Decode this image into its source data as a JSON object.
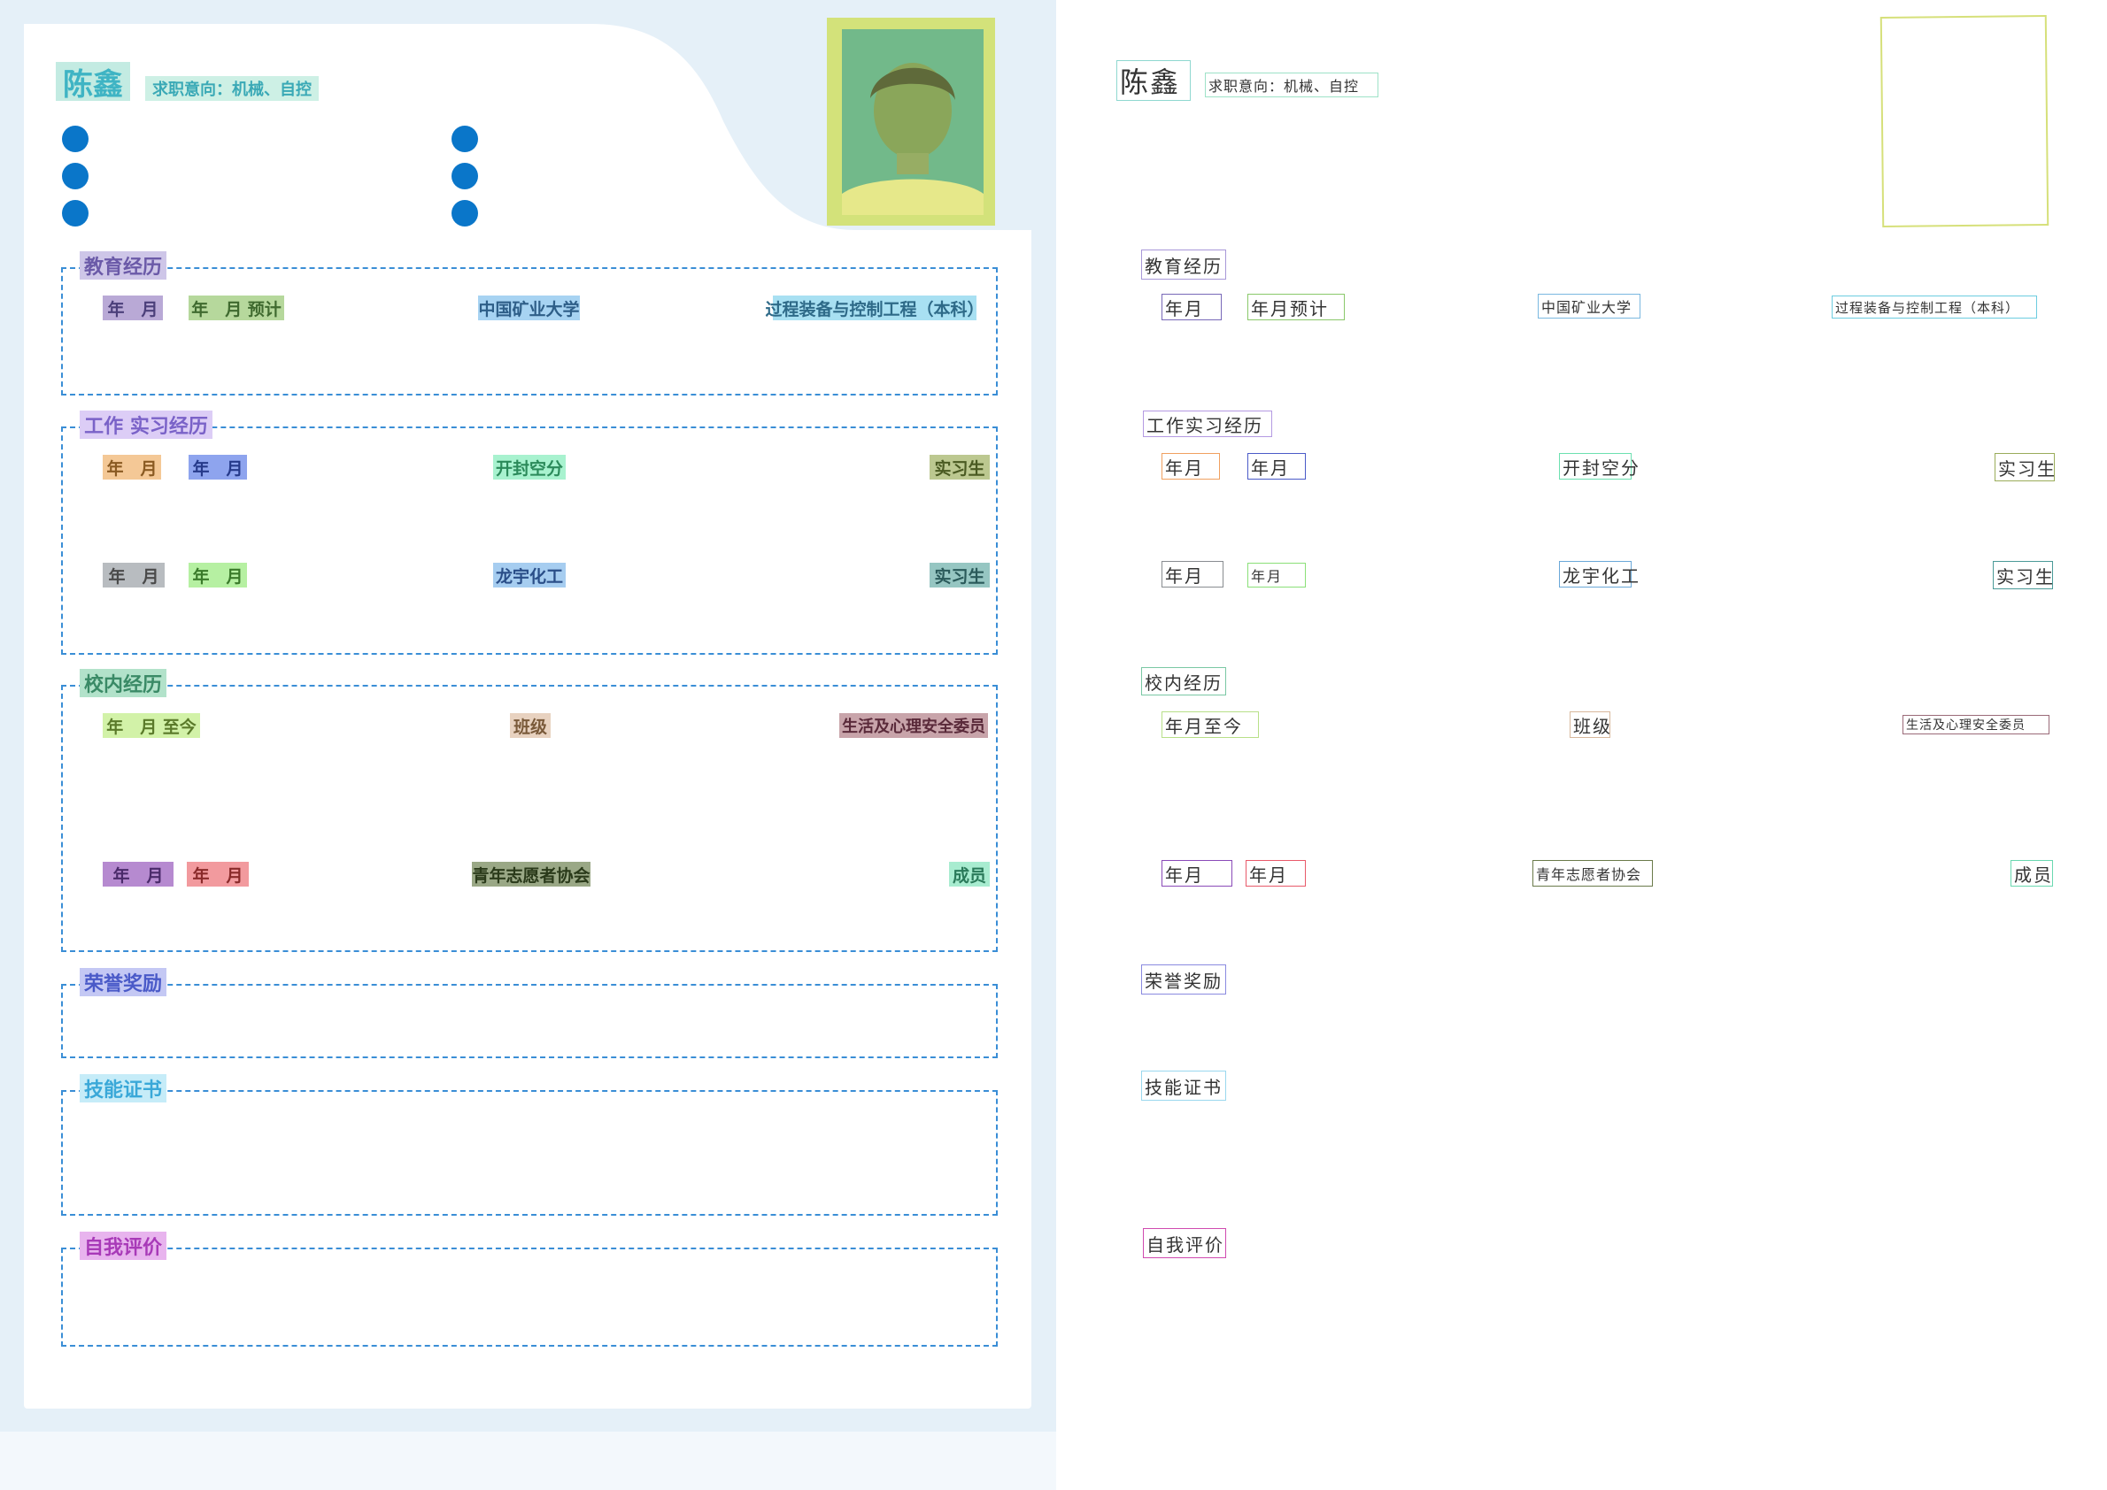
{
  "resume": {
    "name": "陈鑫",
    "job_intent": "求职意向：机械、自控",
    "sections": {
      "education": "教育经历",
      "work": "工作 实习经历",
      "campus": "校内经历",
      "honors": "荣誉奖励",
      "skills": "技能证书",
      "self_eval": "自我评价"
    },
    "education_rows": [
      {
        "start": "年　月",
        "end": "年　月 预计",
        "school": "中国矿业大学",
        "major": "过程装备与控制工程（本科）"
      }
    ],
    "work_rows": [
      {
        "start": "年　月",
        "end": "年　月",
        "company": "开封空分",
        "role": "实习生"
      },
      {
        "start": "年　月",
        "end": "年　月",
        "company": "龙宇化工",
        "role": "实习生"
      }
    ],
    "campus_rows": [
      {
        "start": "年　月 至今",
        "org": "班级",
        "role": "生活及心理安全委员"
      },
      {
        "start": "年　月",
        "end": "年　月",
        "org": "青年志愿者协会",
        "role": "成员"
      }
    ]
  },
  "outline": {
    "name": "陈鑫",
    "job_intent": "求职意向：机械、自控",
    "education": "教育经历",
    "edu_start": "年月",
    "edu_end": "年月预计",
    "edu_school": "中国矿业大学",
    "edu_major": "过程装备与控制工程（本科）",
    "work": "工作实习经历",
    "w1_start": "年月",
    "w1_end": "年月",
    "w1_company": "开封空分",
    "w1_role": "实习生",
    "w2_start": "年月",
    "w2_end": "年月",
    "w2_company": "龙宇化工",
    "w2_role": "实习生",
    "campus": "校内经历",
    "c1_start": "年月至今",
    "c1_org": "班级",
    "c1_role": "生活及心理安全委员",
    "c2_start": "年月",
    "c2_end": "年月",
    "c2_org": "青年志愿者协会",
    "c2_role": "成员",
    "honors": "荣誉奖励",
    "skills": "技能证书",
    "self_eval": "自我评价"
  },
  "colors": {
    "accent_blue": "#0a76c9",
    "dashed_border": "#3a8ed6",
    "background_tint": "#e5f0f8"
  },
  "icons": {
    "contact_bullets": "contact-dot-icon"
  }
}
